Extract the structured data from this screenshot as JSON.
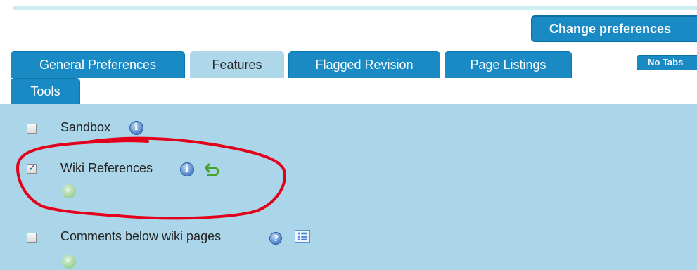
{
  "toolbar": {
    "change_preferences_label": "Change preferences"
  },
  "tabs": [
    {
      "label": "General Preferences",
      "active": false
    },
    {
      "label": "Features",
      "active": true
    },
    {
      "label": "Flagged Revision",
      "active": false
    },
    {
      "label": "Page Listings",
      "active": false
    },
    {
      "label": "Tools",
      "active": false
    }
  ],
  "no_tabs_label": "No Tabs",
  "features": [
    {
      "label": "Sandbox",
      "checked": false,
      "icons": [
        "info-icon"
      ]
    },
    {
      "label": "Wiki References",
      "checked": true,
      "icons": [
        "info-icon",
        "undo-icon",
        "ok-icon"
      ]
    },
    {
      "label": "Comments below wiki pages",
      "checked": false,
      "icons": [
        "help-icon",
        "list-icon",
        "ok-icon"
      ]
    }
  ],
  "colors": {
    "tab_blue": "#1a8ac4",
    "content_bg": "#abd6e9",
    "annotation_red": "#e3001b"
  }
}
